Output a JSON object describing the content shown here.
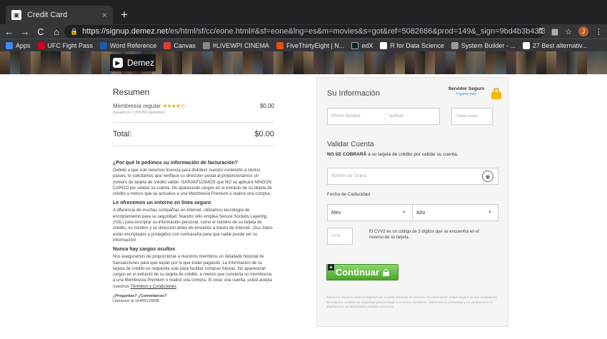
{
  "browser": {
    "tab_title": "Credit Card",
    "tab_close": "×",
    "new_tab": "+",
    "nav": {
      "back": "←",
      "forward": "→",
      "reload": "C",
      "home": "⌂"
    },
    "url_host": "https://signup.demez.net",
    "url_path": "/es/html/sf/cc/eone.html#&sf=eone&lng=es&m=movies&s=got&ref=5082686&prod=149&_sign=9bd4b3b43f3bfaf380c585a835e452dc&_s...",
    "avatar_letter": "J",
    "bookmarks": [
      {
        "label": "Apps",
        "color": "#4285f4"
      },
      {
        "label": "UFC Fight Pass",
        "color": "#d0021b"
      },
      {
        "label": "Word Reference",
        "color": "#1e5aa8"
      },
      {
        "label": "Canvas",
        "color": "#e23c2f"
      },
      {
        "label": "#LIVEWPI CINEMA",
        "color": "#888888"
      },
      {
        "label": "FiveThirtyEight | N...",
        "color": "#e8510c"
      },
      {
        "label": "edX",
        "color": "#02262b"
      },
      {
        "label": "R for Data Science",
        "color": "#ffffff"
      },
      {
        "label": "System Builder - ...",
        "color": "#999999"
      },
      {
        "label": "27 Best alternativ...",
        "color": "#ffffff"
      }
    ]
  },
  "site": {
    "logo": "Demez"
  },
  "summary": {
    "title": "Resumen",
    "membership": "Membresía regular",
    "stars": "★★★★½",
    "based_on": "(basado en 1,350,892 opiniones)",
    "membership_price": "$0.00",
    "total_label": "Total:",
    "total_value": "$0.00"
  },
  "info": {
    "h1": "¿Por qué le pedimos su información de facturación?",
    "p1": "Debido a que solo tenemos licencia para distribuir nuestro contenido a ciertos países, le solicitamos que verifique su dirección postal al proporcionarnos un número de tarjeta de crédito válido. GARANTIZAMOS que NO se aplicará NINGÚN CARGO por validar su cuenta. No aparecerán cargos en el extracto de su tarjeta de crédito a menos que se actualice a una Membresía Premium o realice una compra.",
    "h2": "Le ofrecemos un entorno en línea seguro",
    "p2": "A diferencia de muchas compañías en Internet, utilizamos tecnología de encriptamiento para su seguridad. Nuestro sitio emplea Secure Sockets Layering (SSL) para encriptar su información personal, como el número de su tarjeta de crédito, su nombre y su dirección antes de enviarlos a través de Internet. ¡Sus datos están encriptados y protegidos con contraseña para que nadie pueda ver su información!",
    "h3": "Nunca hay cargos ocultos",
    "p3": "Nos aseguramos de proporcionar a nuestros miembros un detallado historial de transacciones para que sepan por lo que están pagando. La información de su tarjeta de crédito es requerida solo para facilitar compras futuras. No aparecerán cargos en el extracto de su tarjeta de crédito, a menos que convierta su membresía a una Membresía Premium o realice una compra. Al crear una cuenta, usted acepta nuestros",
    "terms_link": "Términos y Condiciones",
    "questions": "¿Preguntas? ¿Comentarios?",
    "phone": "Llámenos al 16465129938"
  },
  "form": {
    "title": "Su Información",
    "secure_title": "Servidor Seguro",
    "secure_link": "Dígame más",
    "first_name_ph": "Primer Nombre",
    "last_name_ph": "Apellido",
    "postal_ph": "Código postal",
    "validate_title": "Validar Cuenta",
    "note_bold": "NO SE COBRARÁ",
    "note_rest": " a su tarjeta de crédito por validar su cuenta.",
    "card_ph": "Número de Tarjeta",
    "expiry_label": "Fecha de Caducidad",
    "month": "Mes",
    "year": "Año",
    "cvv_ph": "CVV2",
    "cvv_text": "El CVV2 es un código de 3 dígitos que se encuentra en el reverso de su tarjeta.",
    "button": "Continuar",
    "disclaimer": "Todos los usuarios están protegidos por nuestra Garantía de Servicio. Su información estará segura ya que empleamos las mejores medidas de seguridad para proteger a nuestros miembros. Valoramos su privacidad y no venderemos ni alquilaremos su información privada a terceros."
  }
}
